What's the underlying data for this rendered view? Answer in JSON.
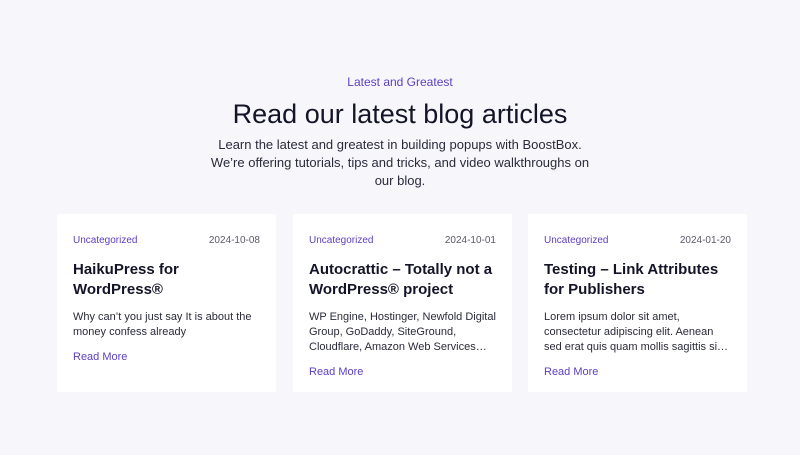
{
  "section": {
    "eyebrow": "Latest and Greatest",
    "heading": "Read our latest blog articles",
    "lead": "Learn the latest and greatest in building popups with BoostBox. We’re offering tutorials, tips and tricks, and video walkthroughs on our blog."
  },
  "posts": [
    {
      "category": "Uncategorized",
      "date": "2024-10-08",
      "title": "HaikuPress for WordPress®",
      "excerpt": "Why can’t you just say It is about the money confess already",
      "read_more": "Read More"
    },
    {
      "category": "Uncategorized",
      "date": "2024-10-01",
      "title": "Autocrattic – Totally not a WordPress® project",
      "excerpt": "WP Engine, Hostinger, Newfold Digital Group, GoDaddy, SiteGround, Cloudflare, Amazon Web Services…",
      "read_more": "Read More"
    },
    {
      "category": "Uncategorized",
      "date": "2024-01-20",
      "title": "Testing – Link Attributes for Publishers",
      "excerpt": "Lorem ipsum dolor sit amet, consectetur adipiscing elit. Aenean sed erat quis quam mollis sagittis si…",
      "read_more": "Read More"
    }
  ],
  "colors": {
    "accent": "#5b3fc4",
    "background": "#f7f7fb",
    "card": "#ffffff",
    "heading": "#141428"
  }
}
